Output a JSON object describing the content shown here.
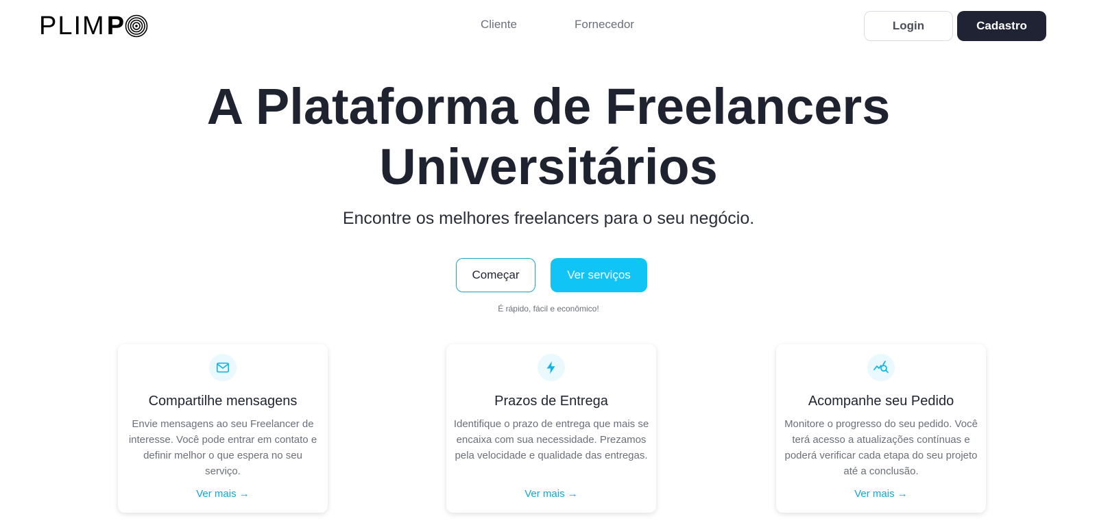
{
  "brand": {
    "logo_text": "PLIM",
    "logo_p": "P"
  },
  "nav": {
    "cliente": "Cliente",
    "fornecedor": "Fornecedor"
  },
  "auth": {
    "login": "Login",
    "cadastro": "Cadastro"
  },
  "hero": {
    "title_line1": "A Plataforma de Freelancers",
    "title_line2": "Universitários",
    "subtitle": "Encontre os melhores freelancers para o seu negócio.",
    "btn_start": "Começar",
    "btn_services": "Ver serviços",
    "note": "É rápido, fácil e econômico!"
  },
  "cards": [
    {
      "icon": "mail-icon",
      "title": "Compartilhe mensagens",
      "description": "Envie mensagens ao seu Freelancer de interesse. Você pode entrar em contato e definir melhor o que espera no seu serviço.",
      "link": "Ver mais →"
    },
    {
      "icon": "lightning-icon",
      "title": "Prazos de Entrega",
      "description": "Identifique o prazo de entrega que mais se encaixa com sua necessidade. Prezamos pela velocidade e qualidade das entregas.",
      "link": "Ver mais →"
    },
    {
      "icon": "chart-search-icon",
      "title": "Acompanhe seu Pedido",
      "description": "Monitore o progresso do seu pedido. Você terá acesso a atualizações contínuas e poderá verificar cada etapa do seu projeto até a conclusão.",
      "link": "Ver mais →"
    }
  ],
  "colors": {
    "accent": "#10c4f5",
    "dark": "#1f2333",
    "muted": "#6b7078"
  }
}
